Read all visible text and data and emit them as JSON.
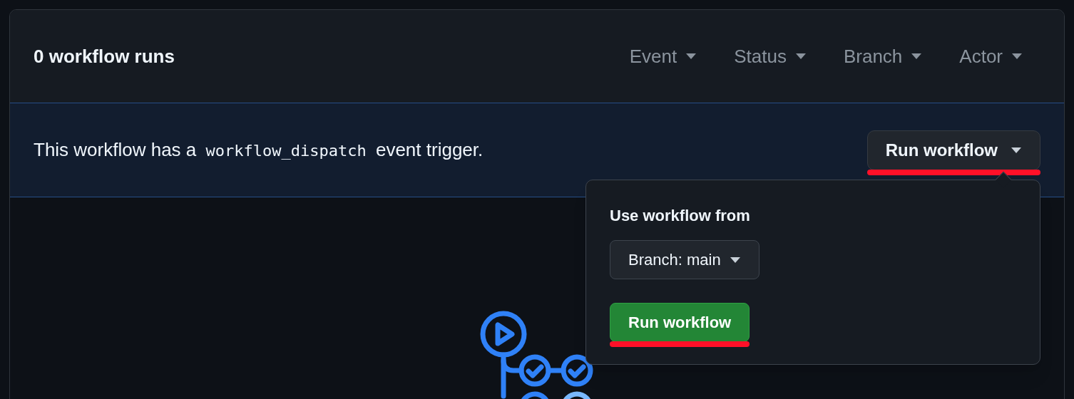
{
  "header": {
    "title": "0 workflow runs",
    "filters": [
      {
        "label": "Event"
      },
      {
        "label": "Status"
      },
      {
        "label": "Branch"
      },
      {
        "label": "Actor"
      }
    ]
  },
  "banner": {
    "text_before": "This workflow has a",
    "code": "workflow_dispatch",
    "text_after": "event trigger.",
    "button": {
      "label": "Run workflow",
      "underlined": true
    }
  },
  "popover": {
    "heading": "Use workflow from",
    "branch_select": {
      "label": "Branch: main"
    },
    "run_button": {
      "label": "Run workflow",
      "underlined": true
    }
  }
}
